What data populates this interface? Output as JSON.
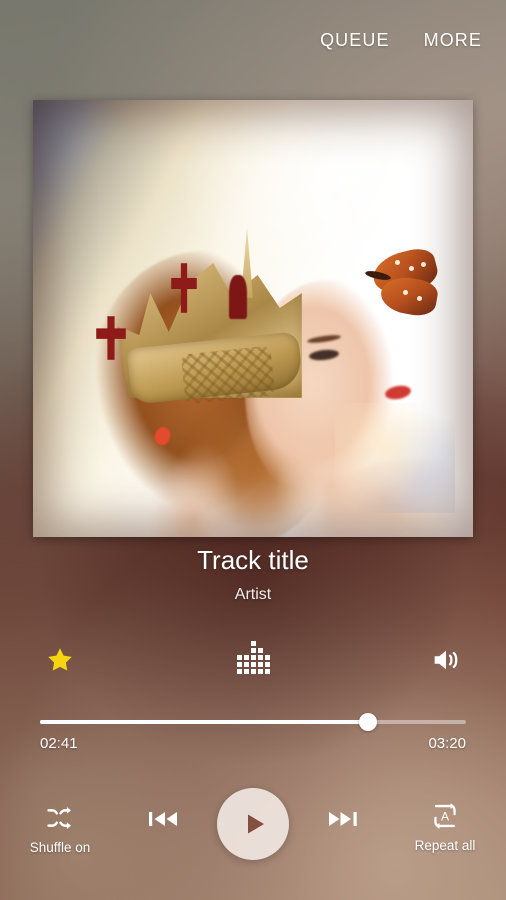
{
  "app": {
    "screen_name": "Now Playing"
  },
  "topbar": {
    "queue_label": "QUEUE",
    "more_label": "MORE"
  },
  "album_art": {
    "alt": "Woman wearing a golden crown with a butterfly",
    "icon": "album-art"
  },
  "track": {
    "title": "Track title",
    "artist": "Artist"
  },
  "quick_actions": {
    "favorite": {
      "icon": "star-icon",
      "state": "on",
      "color": "#F6D411"
    },
    "equalizer": {
      "icon": "equalizer-icon",
      "color": "#FFFFFF"
    },
    "volume": {
      "icon": "volume-icon",
      "color": "#FFFFFF"
    }
  },
  "progress": {
    "current_time": "02:41",
    "total_time": "03:20",
    "percent": 77,
    "fill_color": "#FFFFFF",
    "track_color": "#FFFFFF6B"
  },
  "controls": {
    "shuffle": {
      "icon": "shuffle-icon",
      "label": "Shuffle on"
    },
    "previous": {
      "icon": "previous-track-icon",
      "label": ""
    },
    "play": {
      "icon": "play-icon",
      "label": ""
    },
    "next": {
      "icon": "next-track-icon",
      "label": ""
    },
    "repeat": {
      "icon": "repeat-all-icon",
      "label": "Repeat all"
    }
  }
}
